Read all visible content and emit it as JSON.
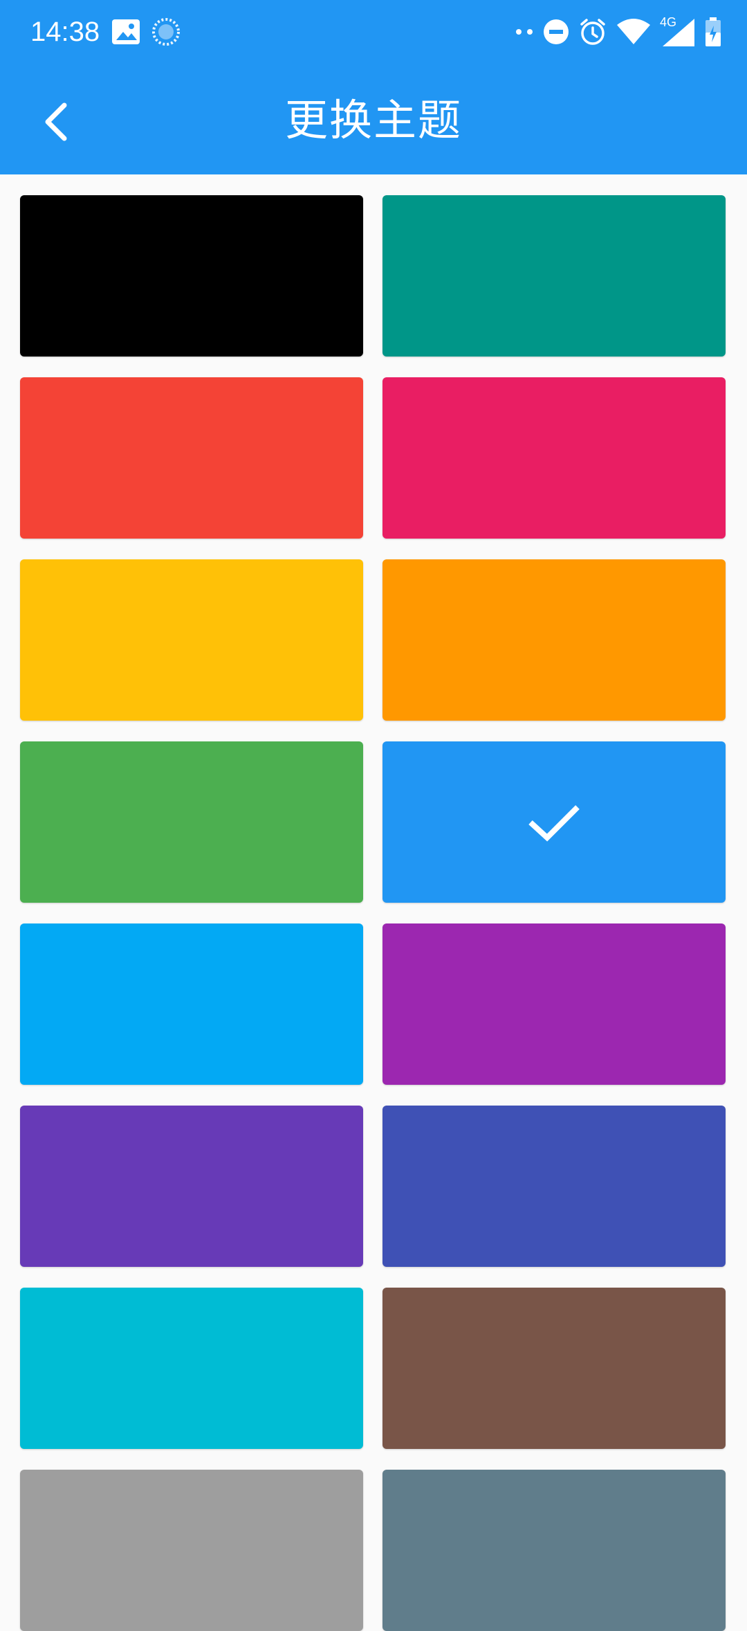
{
  "status_bar": {
    "time": "14:38",
    "network": "4G",
    "icons": [
      "image-icon",
      "loading-icon",
      "dots-icon",
      "dnd-icon",
      "alarm-icon",
      "wifi-icon",
      "signal-icon",
      "battery-icon"
    ]
  },
  "app_bar": {
    "title": "更换主题",
    "back_icon": "chevron-left-icon"
  },
  "theme_swatches": [
    {
      "name": "black",
      "color": "#000000",
      "selected": false
    },
    {
      "name": "teal",
      "color": "#009688",
      "selected": false
    },
    {
      "name": "red",
      "color": "#f44336",
      "selected": false
    },
    {
      "name": "pink",
      "color": "#e91e63",
      "selected": false
    },
    {
      "name": "amber",
      "color": "#ffc107",
      "selected": false
    },
    {
      "name": "orange",
      "color": "#ff9800",
      "selected": false
    },
    {
      "name": "green",
      "color": "#4caf50",
      "selected": false
    },
    {
      "name": "blue",
      "color": "#2196f3",
      "selected": true
    },
    {
      "name": "light-blue",
      "color": "#03a9f4",
      "selected": false
    },
    {
      "name": "purple",
      "color": "#9c27b0",
      "selected": false
    },
    {
      "name": "deep-purple",
      "color": "#673ab7",
      "selected": false
    },
    {
      "name": "indigo",
      "color": "#3f51b5",
      "selected": false
    },
    {
      "name": "cyan",
      "color": "#00bcd4",
      "selected": false
    },
    {
      "name": "brown",
      "color": "#795548",
      "selected": false
    },
    {
      "name": "grey",
      "color": "#9e9e9e",
      "selected": false
    },
    {
      "name": "blue-grey",
      "color": "#607d8b",
      "selected": false
    }
  ],
  "colors": {
    "primary": "#2196f3",
    "background": "#fafafa"
  }
}
